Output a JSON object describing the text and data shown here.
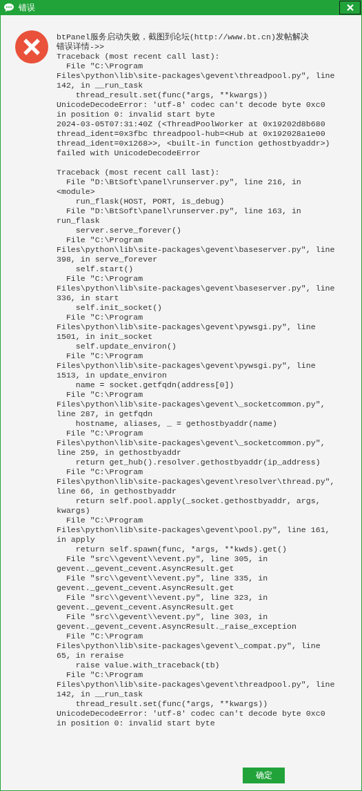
{
  "window": {
    "title": "错误"
  },
  "heading": "btPanel服务启动失败，截图到论坛(http://www.bt.cn)发帖解决错误详情->>",
  "message": "Traceback (most recent call last):\n  File \"C:\\Program\nFiles\\python\\lib\\site-packages\\gevent\\threadpool.py\", line\n142, in __run_task\n    thread_result.set(func(*args, **kwargs))\nUnicodeDecodeError: 'utf-8' codec can't decode byte 0xc0\nin position 0: invalid start byte\n2024-03-05T07:31:40Z (<ThreadPoolWorker at 0x19202d8b680\nthread_ident=0x3fbc threadpool-hub=<Hub at 0x192028a1e00\nthread_ident=0x1268>>, <built-in function gethostbyaddr>)\nfailed with UnicodeDecodeError\n\nTraceback (most recent call last):\n  File \"D:\\BtSoft\\panel\\runserver.py\", line 216, in\n<module>\n    run_flask(HOST, PORT, is_debug)\n  File \"D:\\BtSoft\\panel\\runserver.py\", line 163, in\nrun_flask\n    server.serve_forever()\n  File \"C:\\Program\nFiles\\python\\lib\\site-packages\\gevent\\baseserver.py\", line\n398, in serve_forever\n    self.start()\n  File \"C:\\Program\nFiles\\python\\lib\\site-packages\\gevent\\baseserver.py\", line\n336, in start\n    self.init_socket()\n  File \"C:\\Program\nFiles\\python\\lib\\site-packages\\gevent\\pywsgi.py\", line\n1501, in init_socket\n    self.update_environ()\n  File \"C:\\Program\nFiles\\python\\lib\\site-packages\\gevent\\pywsgi.py\", line\n1513, in update_environ\n    name = socket.getfqdn(address[0])\n  File \"C:\\Program\nFiles\\python\\lib\\site-packages\\gevent\\_socketcommon.py\",\nline 287, in getfqdn\n    hostname, aliases, _ = gethostbyaddr(name)\n  File \"C:\\Program\nFiles\\python\\lib\\site-packages\\gevent\\_socketcommon.py\",\nline 259, in gethostbyaddr\n    return get_hub().resolver.gethostbyaddr(ip_address)\n  File \"C:\\Program\nFiles\\python\\lib\\site-packages\\gevent\\resolver\\thread.py\",\nline 66, in gethostbyaddr\n    return self.pool.apply(_socket.gethostbyaddr, args,\nkwargs)\n  File \"C:\\Program\nFiles\\python\\lib\\site-packages\\gevent\\pool.py\", line 161,\nin apply\n    return self.spawn(func, *args, **kwds).get()\n  File \"src\\\\gevent\\\\event.py\", line 305, in\ngevent._gevent_cevent.AsyncResult.get\n  File \"src\\\\gevent\\\\event.py\", line 335, in\ngevent._gevent_cevent.AsyncResult.get\n  File \"src\\\\gevent\\\\event.py\", line 323, in\ngevent._gevent_cevent.AsyncResult.get\n  File \"src\\\\gevent\\\\event.py\", line 303, in\ngevent._gevent_cevent.AsyncResult._raise_exception\n  File \"C:\\Program\nFiles\\python\\lib\\site-packages\\gevent\\_compat.py\", line\n65, in reraise\n    raise value.with_traceback(tb)\n  File \"C:\\Program\nFiles\\python\\lib\\site-packages\\gevent\\threadpool.py\", line\n142, in __run_task\n    thread_result.set(func(*args, **kwargs))\nUnicodeDecodeError: 'utf-8' codec can't decode byte 0xc0\nin position 0: invalid start byte",
  "buttons": [
    {
      "label": "确定"
    }
  ]
}
